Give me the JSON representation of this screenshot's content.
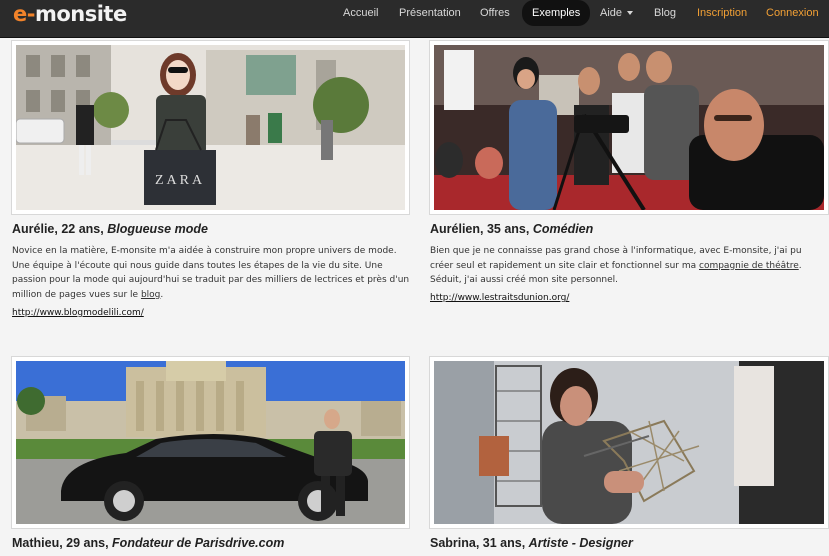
{
  "header": {
    "logo_prefix": "e-",
    "logo_main": "monsite",
    "nav": [
      {
        "label": "Accueil"
      },
      {
        "label": "Présentation"
      },
      {
        "label": "Offres"
      },
      {
        "label": "Exemples"
      },
      {
        "label": "Aide"
      },
      {
        "label": "Blog"
      },
      {
        "label": "Inscription"
      },
      {
        "label": "Connexion"
      }
    ],
    "colors": {
      "bar": "#2b2b2b",
      "accent": "#f2832a"
    }
  },
  "testimonials": [
    {
      "name": "Aurélie, 22 ans,",
      "role": "Blogueuse mode",
      "desc_1": "Novice en la matière, E-monsite m'a aidée à construire mon propre univers de mode. Une équipe à l'écoute qui nous guide dans toutes les étapes de la vie du site. Une passion pour la mode qui aujourd'hui se traduit par des milliers de lectrices et près d'un million de pages vues sur le ",
      "desc_link": "blog",
      "desc_2": ".",
      "url": "http://www.blogmodelili.com/",
      "bag_text": "ZARA"
    },
    {
      "name": "Aurélien, 35 ans,",
      "role": "Comédien",
      "desc_1": "Bien que je ne connaisse pas grand chose à l'informatique, avec E-monsite, j'ai pu créer seul et rapidement un site clair et fonctionnel sur ma ",
      "desc_link": "compagnie de théâtre",
      "desc_2": ". Séduit, j'ai aussi créé mon site personnel.",
      "url": "http://www.lestraitsdunion.org/"
    },
    {
      "name": "Mathieu, 29 ans,",
      "role": "Fondateur de Parisdrive.com"
    },
    {
      "name": "Sabrina, 31 ans,",
      "role": "Artiste - Designer"
    }
  ]
}
